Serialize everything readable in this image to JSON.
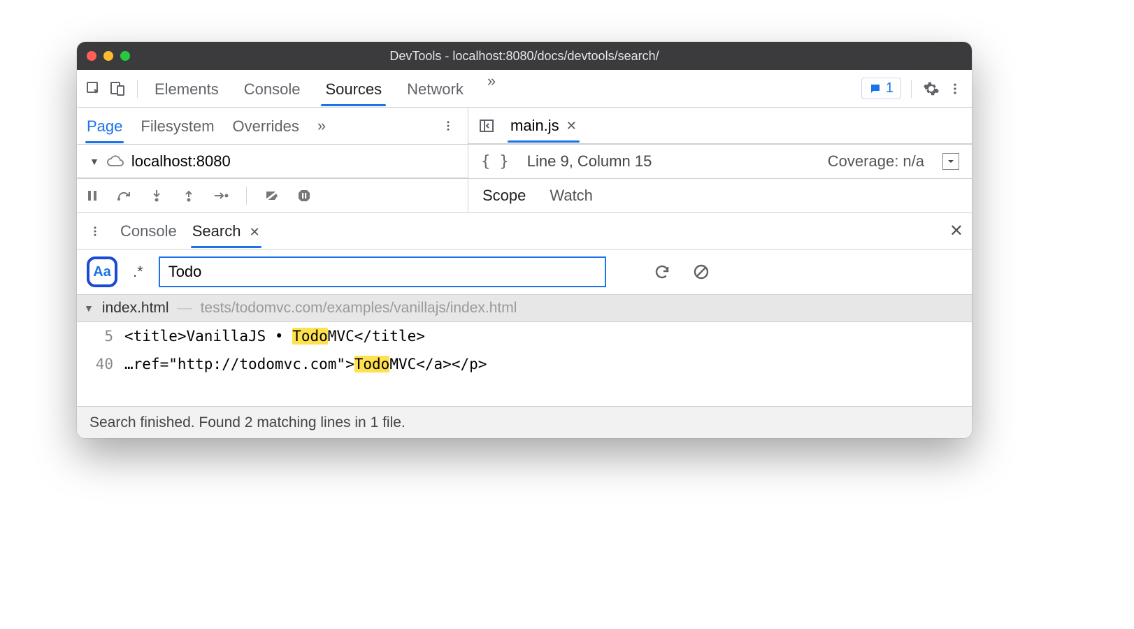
{
  "window_title": "DevTools - localhost:8080/docs/devtools/search/",
  "main_tabs": {
    "t0": "Elements",
    "t1": "Console",
    "t2": "Sources",
    "t3": "Network"
  },
  "message_count": "1",
  "sources_subtabs": {
    "t0": "Page",
    "t1": "Filesystem",
    "t2": "Overrides"
  },
  "tree_root": "localhost:8080",
  "editor": {
    "filename": "main.js",
    "cursor": "Line 9, Column 15",
    "coverage": "Coverage: n/a"
  },
  "debug_right_tabs": {
    "t0": "Scope",
    "t1": "Watch"
  },
  "drawer": {
    "t0": "Console",
    "t1": "Search"
  },
  "search": {
    "case_label": "Aa",
    "regex_label": ".*",
    "value": "Todo"
  },
  "results": {
    "file_name": "index.html",
    "file_path": "tests/todomvc.com/examples/vanillajs/index.html",
    "lines": [
      {
        "n": "5",
        "pre": "<title>VanillaJS • ",
        "hit": "Todo",
        "post": "MVC</title>"
      },
      {
        "n": "40",
        "pre": "…ref=\"http://todomvc.com\">",
        "hit": "Todo",
        "post": "MVC</a></p>"
      }
    ]
  },
  "status_footer": "Search finished.  Found 2 matching lines in 1 file."
}
